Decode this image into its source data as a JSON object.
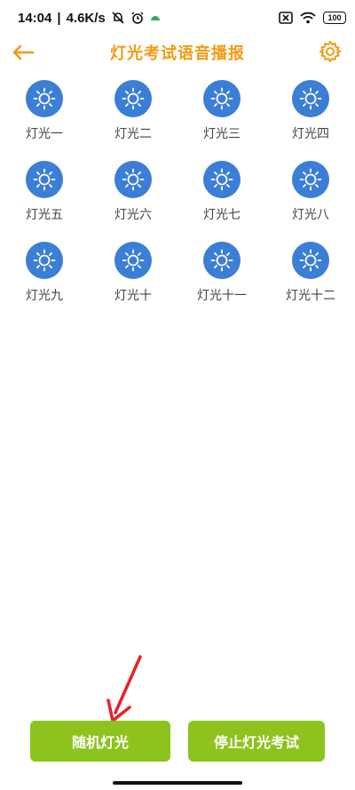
{
  "status_bar": {
    "time": "14:04",
    "speed": "4.6K/s",
    "battery": "100",
    "colors": {
      "app_dot": "#2fae5f"
    }
  },
  "header": {
    "title": "灯光考试语音播报",
    "back_icon": "arrow-left-icon",
    "settings_icon": "gear-icon",
    "colors": {
      "accent": "#f29b12"
    }
  },
  "lights": [
    {
      "label": "灯光一",
      "icon": "sun-icon"
    },
    {
      "label": "灯光二",
      "icon": "sun-icon"
    },
    {
      "label": "灯光三",
      "icon": "sun-icon"
    },
    {
      "label": "灯光四",
      "icon": "sun-icon"
    },
    {
      "label": "灯光五",
      "icon": "sun-icon"
    },
    {
      "label": "灯光六",
      "icon": "sun-icon"
    },
    {
      "label": "灯光七",
      "icon": "sun-icon"
    },
    {
      "label": "灯光八",
      "icon": "sun-icon"
    },
    {
      "label": "灯光九",
      "icon": "sun-icon"
    },
    {
      "label": "灯光十",
      "icon": "sun-icon"
    },
    {
      "label": "灯光十一",
      "icon": "sun-icon"
    },
    {
      "label": "灯光十二",
      "icon": "sun-icon"
    }
  ],
  "buttons": {
    "random_label": "随机灯光",
    "stop_label": "停止灯光考试",
    "colors": {
      "button_bg": "#8cc31d",
      "icon_bg": "#3b7ed6",
      "annotation": "#e8202a"
    }
  }
}
